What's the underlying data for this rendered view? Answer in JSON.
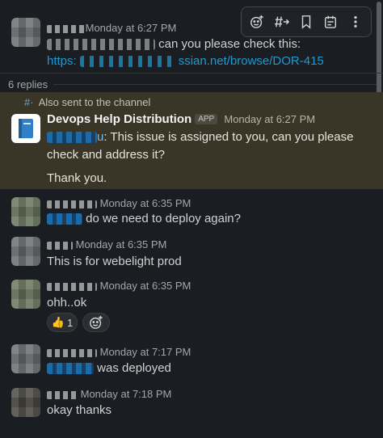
{
  "toolbar": {
    "items": [
      {
        "icon": "add-reaction-icon"
      },
      {
        "icon": "reply-in-thread-icon"
      },
      {
        "icon": "bookmark-icon"
      },
      {
        "icon": "forward-icon"
      },
      {
        "icon": "more-actions-icon"
      }
    ]
  },
  "parent": {
    "timestamp": "Monday at 6:27 PM",
    "text": "can you please check this:",
    "link": "https:// ... ssian.net/browse/DOR-415",
    "link_visible_suffix": "ssian.net/browse/DOR-415",
    "link_visible_prefix": "https:"
  },
  "thread": {
    "replies_label": "6 replies"
  },
  "bot_message": {
    "also_sent": "Also sent to the channel",
    "sender": "Devops Help Distribution",
    "badge": "APP",
    "timestamp": "Monday at 6:27 PM",
    "mention_suffix": "u",
    "line1": ": This issue is assigned to you, can you please",
    "line2": "check and address it?",
    "line3": "Thank you."
  },
  "replies": [
    {
      "timestamp": "Monday at 6:35 PM",
      "text": "do we need to deploy again?"
    },
    {
      "timestamp": "Monday at 6:35 PM",
      "text": "This is for webelight prod"
    },
    {
      "timestamp": "Monday at 6:35 PM",
      "text": "ohh..ok",
      "reaction": {
        "emoji": "👍",
        "count": "1"
      }
    },
    {
      "timestamp": "Monday at 7:17 PM",
      "text": "was deployed"
    },
    {
      "timestamp": "Monday at 7:18 PM",
      "text": "okay thanks"
    }
  ],
  "colors": {
    "background": "#1a1d21",
    "highlight": "#3a3627",
    "link": "#1d9bd1"
  }
}
